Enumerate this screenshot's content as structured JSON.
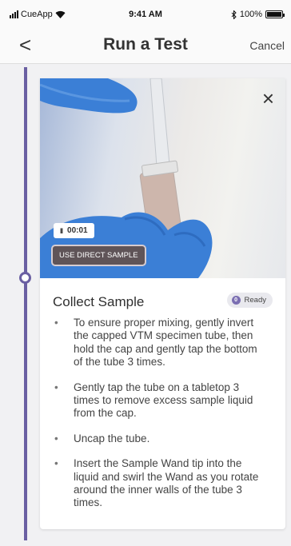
{
  "status_bar": {
    "carrier": "CueApp",
    "time": "9:41 AM",
    "battery": "100%",
    "battery_level": 1.0
  },
  "nav": {
    "back_icon": "chevron-left-icon",
    "back_glyph": "<",
    "title": "Run a Test",
    "cancel_label": "Cancel"
  },
  "video": {
    "close_glyph": "×",
    "pause_glyph": "II",
    "elapsed": "00:01",
    "direct_sample_label": "USE DIRECT SAMPLE"
  },
  "step": {
    "title": "Collect Sample",
    "badge_label": "Ready",
    "badge_glyph": "0",
    "instructions": [
      "To ensure proper mixing, gently invert the capped VTM specimen tube, then hold the cap and gently tap the bottom of the tube 3 times.",
      "Gently tap the tube on a tabletop 3 times to remove excess sample liquid from the cap.",
      "Uncap the tube.",
      "Insert the Sample Wand tip into the liquid and swirl the Wand as you rotate around the inner walls of the tube 3 times."
    ]
  },
  "colors": {
    "accent": "#6a5fa2",
    "glove": "#3b7fd6",
    "background": "#f1f1f3"
  }
}
